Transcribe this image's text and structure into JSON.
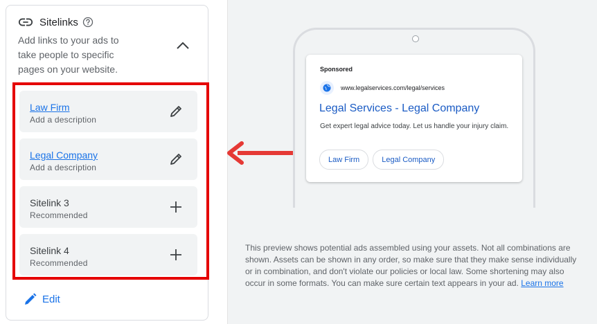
{
  "sitelinks": {
    "title": "Sitelinks",
    "subtitle": "Add links to your ads to take people to specific pages on your website.",
    "items": [
      {
        "title": "Law Firm",
        "description": "Add a description",
        "action_icon": "pencil-icon"
      },
      {
        "title": "Legal Company",
        "description": "Add a description",
        "action_icon": "pencil-icon"
      },
      {
        "title": "Sitelink 3",
        "description": "Recommended",
        "action_icon": "plus-icon"
      },
      {
        "title": "Sitelink 4",
        "description": "Recommended",
        "action_icon": "plus-icon"
      }
    ],
    "edit_label": "Edit"
  },
  "preview": {
    "sponsored": "Sponsored",
    "url": "www.legalservices.com/legal/services",
    "headline": "Legal Services - Legal Company",
    "description": "Get expert legal advice today. Let us handle your injury claim.",
    "chips": [
      "Law Firm",
      "Legal Company"
    ]
  },
  "disclaimer": {
    "text": "This preview shows potential ads assembled using your assets. Not all combinations are shown. Assets can be shown in any order, so make sure that they make sense individually or in combination, and don't violate our policies or local law. Some shortening may also occur in some formats. You can make sure certain text appears in your ad.",
    "link": "Learn more"
  },
  "colors": {
    "accent": "#1a73e8",
    "highlight": "#e50000",
    "arrow": "#e53935"
  }
}
